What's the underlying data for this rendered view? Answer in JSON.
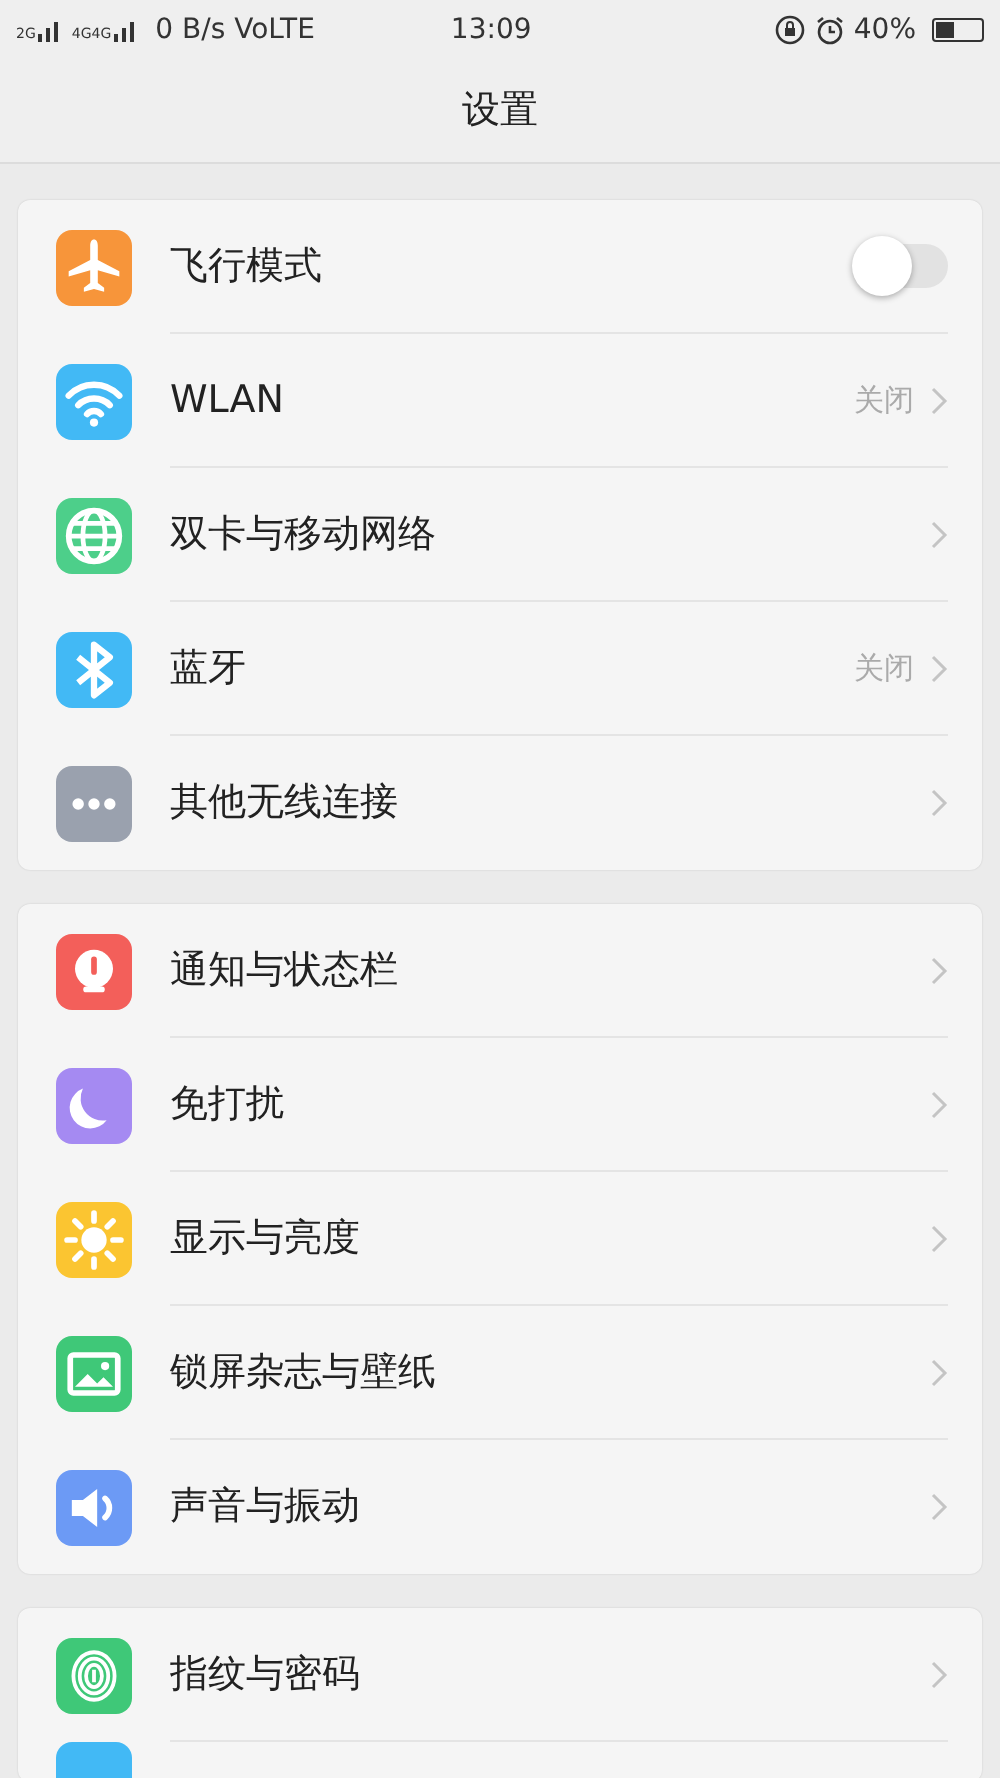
{
  "status_bar": {
    "network_labels": [
      "2G",
      "4G",
      "4G"
    ],
    "speed": "0 B/s VoLTE",
    "time": "13:09",
    "battery_text": "40%"
  },
  "header": {
    "title": "设置"
  },
  "sections": [
    {
      "items": [
        {
          "label": "飞行模式",
          "kind": "toggle",
          "on": false
        },
        {
          "label": "WLAN",
          "kind": "value",
          "value": "关闭"
        },
        {
          "label": "双卡与移动网络",
          "kind": "link"
        },
        {
          "label": "蓝牙",
          "kind": "value",
          "value": "关闭"
        },
        {
          "label": "其他无线连接",
          "kind": "link"
        }
      ]
    },
    {
      "items": [
        {
          "label": "通知与状态栏",
          "kind": "link"
        },
        {
          "label": "免打扰",
          "kind": "link"
        },
        {
          "label": "显示与亮度",
          "kind": "link"
        },
        {
          "label": "锁屏杂志与壁纸",
          "kind": "link"
        },
        {
          "label": "声音与振动",
          "kind": "link"
        }
      ]
    },
    {
      "items": [
        {
          "label": "指纹与密码",
          "kind": "link"
        },
        {
          "kind": "cut"
        }
      ]
    }
  ]
}
